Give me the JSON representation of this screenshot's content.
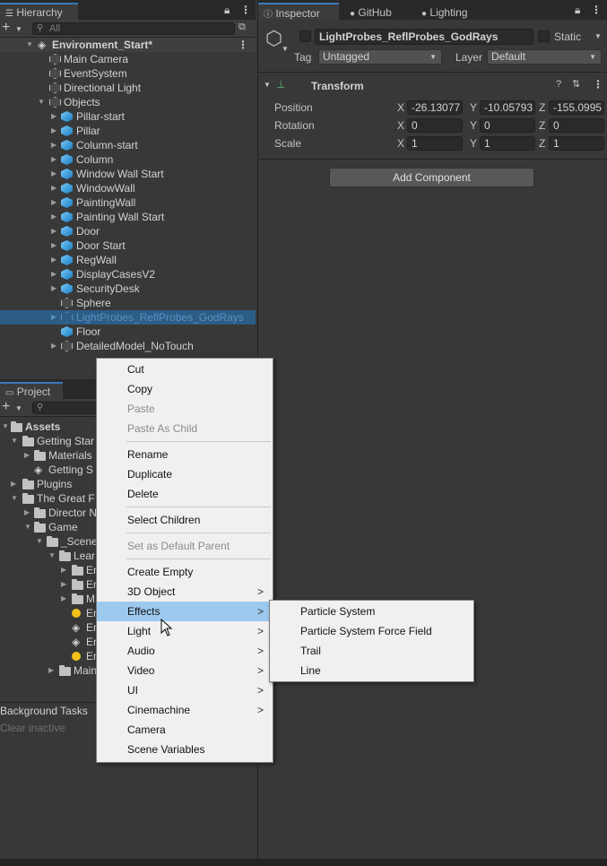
{
  "hierarchy": {
    "tab_label": "Hierarchy",
    "search_placeholder": "All",
    "scene_name": "Environment_Start*",
    "items": [
      {
        "label": "Main Camera"
      },
      {
        "label": "EventSystem"
      },
      {
        "label": "Directional Light"
      },
      {
        "label": "Objects"
      },
      {
        "label": "Pillar-start"
      },
      {
        "label": "Pillar"
      },
      {
        "label": "Column-start"
      },
      {
        "label": "Column"
      },
      {
        "label": "Window Wall Start"
      },
      {
        "label": "WindowWall"
      },
      {
        "label": "PaintingWall"
      },
      {
        "label": "Painting Wall Start"
      },
      {
        "label": "Door"
      },
      {
        "label": "Door Start"
      },
      {
        "label": "RegWall"
      },
      {
        "label": "DisplayCasesV2"
      },
      {
        "label": "SecurityDesk"
      },
      {
        "label": "Sphere"
      },
      {
        "label": "LightProbes_ReflProbes_GodRays"
      },
      {
        "label": "Floor"
      },
      {
        "label": "DetailedModel_NoTouch"
      }
    ]
  },
  "project": {
    "tab_label": "Project",
    "items": [
      {
        "label": "Assets"
      },
      {
        "label": "Getting Star"
      },
      {
        "label": "Materials"
      },
      {
        "label": "Getting S"
      },
      {
        "label": "Plugins"
      },
      {
        "label": "The Great F"
      },
      {
        "label": "Director N"
      },
      {
        "label": "Game"
      },
      {
        "label": "_Scene"
      },
      {
        "label": "Lear"
      },
      {
        "label": "En"
      },
      {
        "label": "En"
      },
      {
        "label": "M"
      },
      {
        "label": "En"
      },
      {
        "label": "En"
      },
      {
        "label": "En"
      },
      {
        "label": "En"
      },
      {
        "label": "Main"
      }
    ]
  },
  "background_tasks": {
    "title": "Background Tasks",
    "clear_label": "Clear inactive"
  },
  "inspector": {
    "tabs": [
      {
        "label": "Inspector"
      },
      {
        "label": "GitHub"
      },
      {
        "label": "Lighting"
      }
    ],
    "object_name": "LightProbes_ReflProbes_GodRays",
    "static_label": "Static",
    "tag_label": "Tag",
    "tag_value": "Untagged",
    "layer_label": "Layer",
    "layer_value": "Default",
    "transform_title": "Transform",
    "position_label": "Position",
    "rotation_label": "Rotation",
    "scale_label": "Scale",
    "axis_x": "X",
    "axis_y": "Y",
    "axis_z": "Z",
    "position": {
      "x": "-26.13077",
      "y": "-10.05793",
      "z": "-155.0995"
    },
    "rotation": {
      "x": "0",
      "y": "0",
      "z": "0"
    },
    "scale": {
      "x": "1",
      "y": "1",
      "z": "1"
    },
    "add_component_label": "Add Component"
  },
  "context_menu": {
    "items": [
      {
        "label": "Cut"
      },
      {
        "label": "Copy"
      },
      {
        "label": "Paste"
      },
      {
        "label": "Paste As Child"
      },
      {
        "label": "Rename"
      },
      {
        "label": "Duplicate"
      },
      {
        "label": "Delete"
      },
      {
        "label": "Select Children"
      },
      {
        "label": "Set as Default Parent"
      },
      {
        "label": "Create Empty"
      },
      {
        "label": "3D Object"
      },
      {
        "label": "Effects"
      },
      {
        "label": "Light"
      },
      {
        "label": "Audio"
      },
      {
        "label": "Video"
      },
      {
        "label": "UI"
      },
      {
        "label": "Cinemachine"
      },
      {
        "label": "Camera"
      },
      {
        "label": "Scene Variables"
      }
    ],
    "submenu_glyph": ">"
  },
  "effects_submenu": {
    "items": [
      {
        "label": "Particle System"
      },
      {
        "label": "Particle System Force Field"
      },
      {
        "label": "Trail"
      },
      {
        "label": "Line"
      }
    ]
  },
  "colors": {
    "selection": "#2c5d87",
    "menu_highlight": "#9ec9ef",
    "panel_bg": "#383838"
  }
}
